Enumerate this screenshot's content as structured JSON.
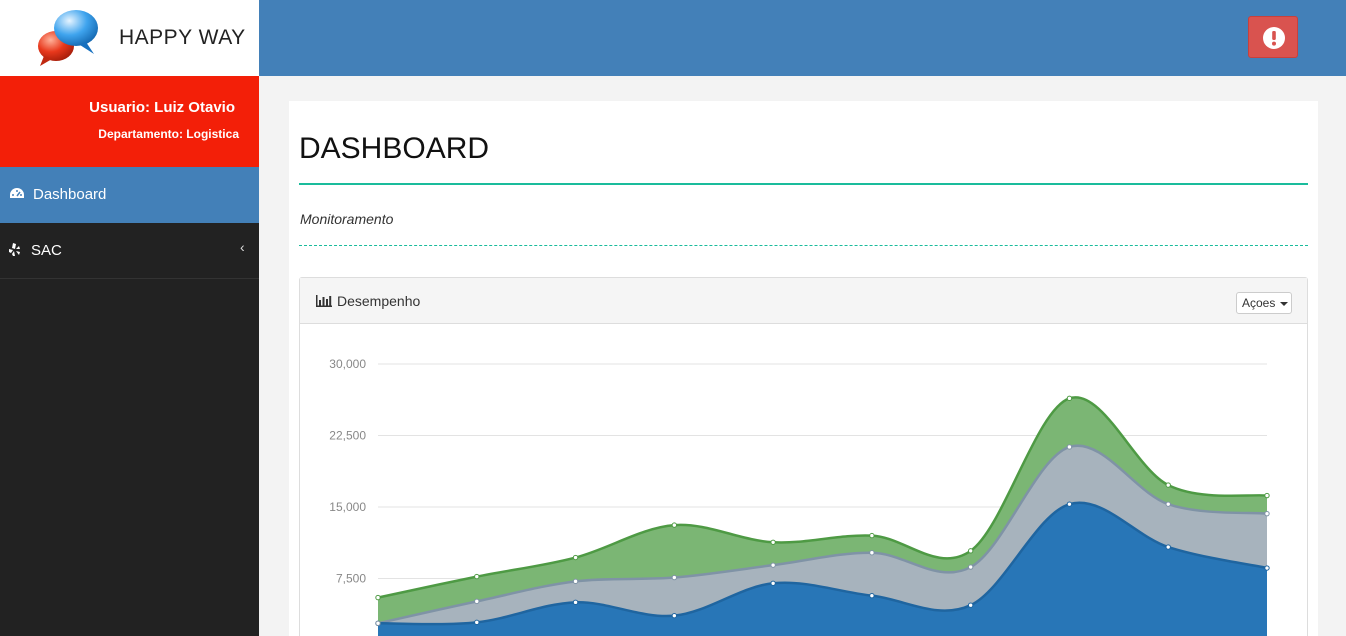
{
  "brand": {
    "name": "HAPPY WAY",
    "logo_icon": "speech-bubbles-icon"
  },
  "topbar": {
    "alert_icon": "exclamation-circle-icon",
    "alert_color": "#d9534f",
    "bar_color": "#4380b8"
  },
  "user": {
    "name": "Usuario: Luiz Otavio",
    "department": "Departamento: Logistica",
    "box_color": "#f31f08"
  },
  "sidebar": {
    "items": [
      {
        "label": "Dashboard",
        "icon": "dashboard-icon",
        "active": true
      },
      {
        "label": "SAC",
        "icon": "yelp-icon",
        "active": false,
        "chevron": "‹"
      }
    ]
  },
  "page": {
    "title": "DASHBOARD",
    "subtitle": "Monitoramento",
    "accent": "#1abc9c"
  },
  "panel": {
    "title": "Desempenho",
    "icon": "bar-chart-icon",
    "actions_label": "Açoes"
  },
  "chart_data": {
    "type": "area",
    "stacked": true,
    "y_ticks": [
      "30,000",
      "22,500",
      "15,000",
      "7,500"
    ],
    "ylim": [
      0,
      30000
    ],
    "grid": true,
    "point_count": 10,
    "series": [
      {
        "color": "#2876b7",
        "values": [
          2800,
          2900,
          5000,
          3600,
          7000,
          5700,
          4700,
          15300,
          10800,
          8600
        ]
      },
      {
        "color": "#a7b3bd",
        "values": [
          0,
          2200,
          2200,
          4000,
          1900,
          4500,
          4000,
          6000,
          4500,
          5700
        ]
      },
      {
        "color": "#7bb674",
        "values": [
          2700,
          2600,
          2500,
          5500,
          2400,
          1800,
          1700,
          5100,
          2000,
          1900
        ]
      }
    ]
  }
}
